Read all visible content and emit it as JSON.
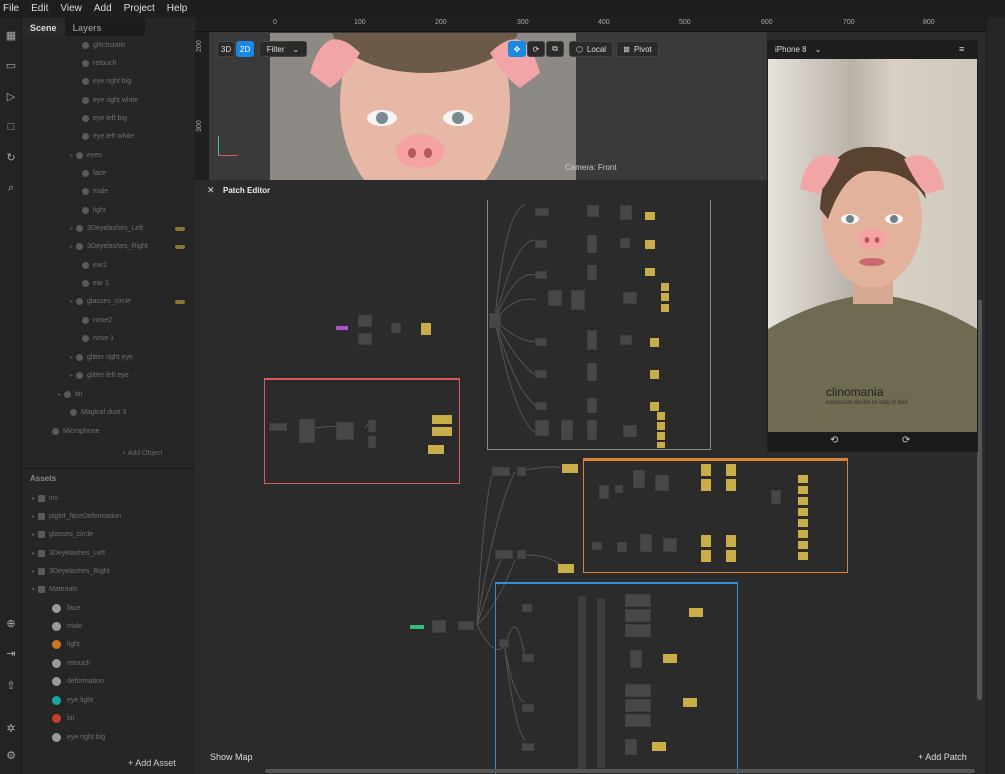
{
  "menu": [
    "File",
    "Edit",
    "View",
    "Add",
    "Project",
    "Help"
  ],
  "scene_panel": {
    "tabs": [
      "Scene",
      "Layers"
    ],
    "items": [
      "glitchstatic",
      "retouch",
      "eye right big",
      "eye right white",
      "eye left big",
      "eye left white",
      "eyes",
      "face",
      "male",
      "light",
      "3Deyelashes_Left",
      "3Deyelashes_Right",
      "ear2",
      "ear 1",
      "glasses_circle",
      "nose2",
      "nose 1",
      "glitter right eye",
      "glitter left eye",
      "bit",
      "Magical dust 3",
      "Microphone"
    ],
    "add_object": "+ Add Object"
  },
  "assets_panel": {
    "title": "Assets",
    "items": [
      "iris",
      "piglet_faceDeformation",
      "glasses_circle",
      "3Deyelashes_Left",
      "3Deyelashes_Right",
      "Materials"
    ],
    "materials": [
      {
        "name": "face",
        "color": "#9a9a9a"
      },
      {
        "name": "male",
        "color": "#9a9a9a"
      },
      {
        "name": "light",
        "color": "#c97a20"
      },
      {
        "name": "retouch",
        "color": "#9a9a9a"
      },
      {
        "name": "deformation",
        "color": "#9a9a9a"
      },
      {
        "name": "eye light",
        "color": "#1aa6a0"
      },
      {
        "name": "bit",
        "color": "#c9402a"
      },
      {
        "name": "eye right big",
        "color": "#9a9a9a"
      }
    ],
    "add_asset": "+ Add Asset"
  },
  "viewport": {
    "ruler_top": [
      "0",
      "100",
      "200",
      "300",
      "400",
      "500",
      "600",
      "700",
      "800"
    ],
    "ruler_left": [
      "200",
      "300"
    ],
    "mode_3d": "3D",
    "mode_2d": "2D",
    "filter": "Filter",
    "local": "Local",
    "pivot": "Pivot",
    "camera": "Camera: Front"
  },
  "patch_editor": {
    "title": "Patch Editor",
    "show_map": "Show Map",
    "add_patch": "+ Add Patch",
    "group_colors": {
      "red": "#d85a5a",
      "orange": "#d8823a",
      "blue": "#2f8fd8",
      "white": "#8a8a8a"
    }
  },
  "simulator": {
    "device": "iPhone 8",
    "brand": "clinomania",
    "tagline": "excessive desire to stay in bed"
  }
}
